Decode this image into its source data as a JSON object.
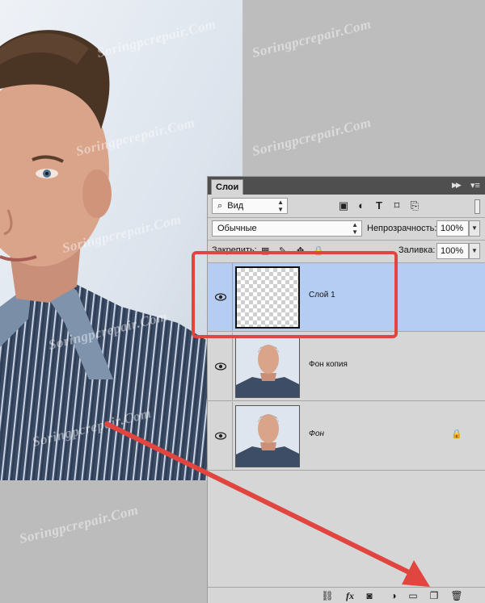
{
  "watermark_text": "Soringpcrepair.Com",
  "panel": {
    "tab_label": "Слои",
    "collapse_icon": "double-chevron-right-icon",
    "menu_icon": "panel-menu-icon"
  },
  "filter": {
    "kind_label": "Вид",
    "search_icon": "search-icon",
    "icons": [
      "image-filter-icon",
      "adjustment-filter-icon",
      "text-filter-icon",
      "shape-filter-icon",
      "smart-object-filter-icon"
    ]
  },
  "blend": {
    "mode": "Обычные",
    "opacity_label": "Непрозрачность:",
    "opacity_value": "100%"
  },
  "locks": {
    "label": "Закрепить:",
    "fill_label": "Заливка:",
    "fill_value": "100%"
  },
  "layers": [
    {
      "name": "Слой 1",
      "selected": true,
      "visible": true,
      "thumbnail": "transparent",
      "locked": false
    },
    {
      "name": "Фон копия",
      "selected": false,
      "visible": true,
      "thumbnail": "photo",
      "locked": false
    },
    {
      "name": "Фон",
      "selected": false,
      "visible": true,
      "thumbnail": "photo",
      "locked": true
    }
  ],
  "bottom_bar": {
    "icons": [
      "link-layers-icon",
      "fx-icon",
      "add-mask-icon",
      "adjustment-layer-icon",
      "new-group-icon",
      "new-layer-icon",
      "delete-layer-icon"
    ],
    "fx_label": "fx"
  },
  "colors": {
    "annotation_red": "#e0463f",
    "selected_row": "#b6cdf3",
    "panel_header": "#4f4f4f"
  }
}
